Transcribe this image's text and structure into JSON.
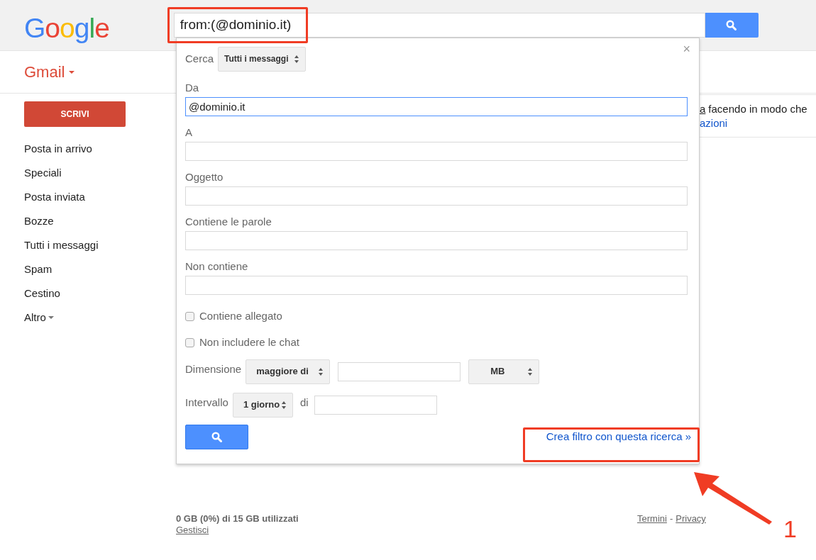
{
  "header": {
    "logo": "Google",
    "search": {
      "value": "from:(@dominio.it)"
    }
  },
  "app": {
    "title": "Gmail"
  },
  "compose_button": "SCRIVI",
  "nav": [
    {
      "label": "Posta in arrivo",
      "kind": "link"
    },
    {
      "label": "Speciali",
      "kind": "link"
    },
    {
      "label": "Posta inviata",
      "kind": "link"
    },
    {
      "label": "Bozze",
      "kind": "link"
    },
    {
      "label": "Tutti i messaggi",
      "kind": "link"
    },
    {
      "label": "Spam",
      "kind": "link"
    },
    {
      "label": "Cestino",
      "kind": "link"
    },
    {
      "label": "Altro",
      "kind": "menu"
    }
  ],
  "search_panel": {
    "close_button": "×",
    "scope": {
      "label": "Cerca",
      "value": "Tutti i messaggi"
    },
    "fields": [
      {
        "label": "Da",
        "value": "@dominio.it",
        "focused": true
      },
      {
        "label": "A",
        "focused": false
      },
      {
        "label": "Oggetto",
        "focused": false
      },
      {
        "label": "Contiene le parole",
        "focused": false
      },
      {
        "label": "Non contiene",
        "focused": false
      }
    ],
    "checkboxes": [
      {
        "label": "Contiene allegato",
        "checked": false
      },
      {
        "label": "Non includere le chat",
        "checked": false
      }
    ],
    "size": {
      "label": "Dimensione",
      "comparator": "maggiore di",
      "unit": "MB"
    },
    "range": {
      "label": "Intervallo",
      "value": "1 giorno",
      "connector": "di"
    },
    "create_filter_link": "Crea filtro con questa ricerca »"
  },
  "background_notice": {
    "link": "a",
    "text": "facendo in modo che",
    "link_2": "azioni"
  },
  "footer": {
    "storage": "0 GB (0%) di 15 GB utilizzati",
    "manage_link": "Gestisci",
    "links": [
      "Termini",
      "Privacy"
    ],
    "separator": "-"
  },
  "annotation": {
    "label": "1"
  }
}
